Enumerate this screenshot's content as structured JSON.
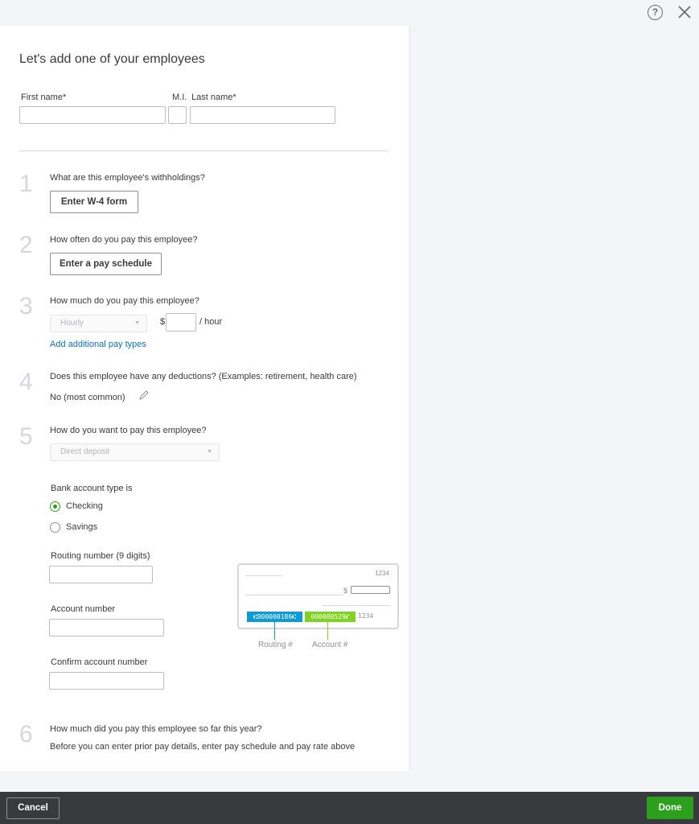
{
  "header": {
    "help_icon": "help-circle-icon",
    "close_icon": "close-icon"
  },
  "title": "Let's add one of your employees",
  "name_fields": {
    "first_label": "First name*",
    "mi_label": "M.I.",
    "last_label": "Last name*",
    "first_value": "",
    "mi_value": "",
    "last_value": ""
  },
  "steps": {
    "s1": {
      "num": "1",
      "question": "What are this employee's withholdings?",
      "button": "Enter W-4 form"
    },
    "s2": {
      "num": "2",
      "question": "How often do you pay this employee?",
      "button": "Enter a pay schedule"
    },
    "s3": {
      "num": "3",
      "question": "How much do you pay this employee?",
      "pay_type": "Hourly",
      "currency": "$",
      "per": "/ hour",
      "link": "Add additional pay types"
    },
    "s4": {
      "num": "4",
      "question": "Does this employee have any deductions? (Examples: retirement, health care)",
      "answer": "No (most common)"
    },
    "s5": {
      "num": "5",
      "question": "How do you want to pay this employee?",
      "method": "Direct deposit",
      "bank_type_label": "Bank account type is",
      "options": [
        "Checking",
        "Savings"
      ],
      "selected": "Checking",
      "routing_label": "Routing number (9 digits)",
      "account_label": "Account number",
      "confirm_label": "Confirm account number"
    },
    "s6": {
      "num": "6",
      "question": "How much did you pay this employee so far this year?",
      "note": "Before you can enter prior pay details, enter pay schedule and pay rate above"
    }
  },
  "check_graphic": {
    "check_number": "1234",
    "routing_code": "⑆000000186⑆",
    "account_code": "000000529⑈",
    "check_code": "1234",
    "routing_caption": "Routing #",
    "account_caption": "Account #",
    "dollar": "$",
    "routing_color": "#0d9bd8",
    "account_color": "#7fd321"
  },
  "footer": {
    "cancel": "Cancel",
    "done": "Done"
  },
  "colors": {
    "accent": "#2ca01c",
    "link": "#0077c5",
    "footer_bg": "#393a3d"
  }
}
